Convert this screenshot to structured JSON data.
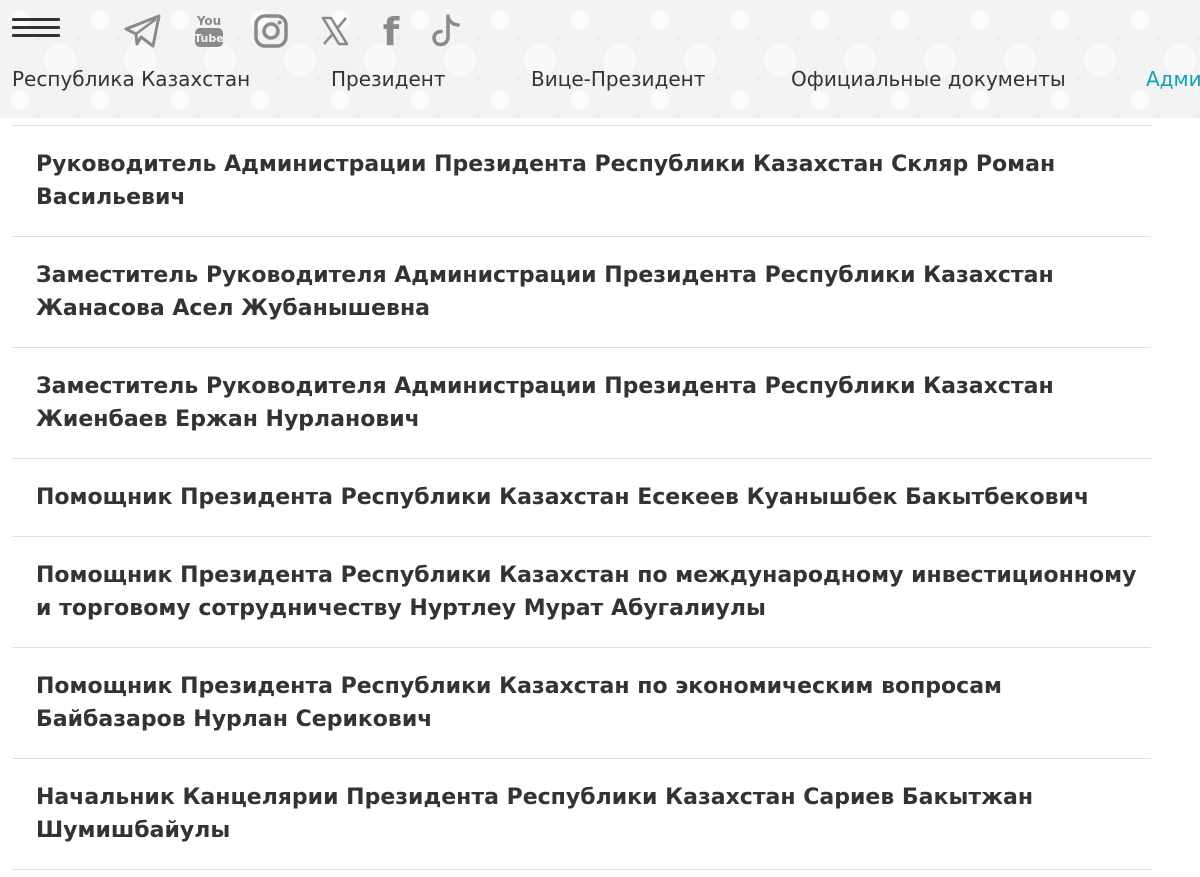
{
  "header": {
    "social_icons": [
      "telegram-icon",
      "youtube-icon",
      "instagram-icon",
      "x-icon",
      "facebook-icon",
      "tiktok-icon"
    ],
    "youtube_text_top": "You",
    "youtube_text_bottom": "Tube",
    "facebook_letter": "f",
    "nav": [
      {
        "label": "Республика Казахстан"
      },
      {
        "label": "Президент"
      },
      {
        "label": "Вице-Президент"
      },
      {
        "label": "Официальные документы"
      },
      {
        "label": "Адми"
      }
    ],
    "active_color": "#0fa3b1",
    "icon_color": "#8a8a8a"
  },
  "officials": [
    {
      "title": "Руководитель Администрации Президента Республики Казахстан Скляр Роман Васильевич"
    },
    {
      "title": "Заместитель Руководителя Администрации Президента Республики Казахстан Жанасова Асел Жубанышевна"
    },
    {
      "title": "Заместитель Руководителя Администрации Президента Республики Казахстан Жиенбаев Ержан Нурланович"
    },
    {
      "title": "Помощник Президента Республики Казахстан Есекеев Куанышбек Бакытбекович"
    },
    {
      "title": "Помощник Президента Республики Казахстан по международному инвестиционному и торговому сотрудничеству Нуртлеу Мурат Абугалиулы"
    },
    {
      "title": "Помощник Президента Республики Казахстан по экономическим вопросам Байбазаров Нурлан Серикович"
    },
    {
      "title": "Начальник Канцелярии Президента Республики Казахстан Сариев Бакытжан Шумишбайулы"
    }
  ]
}
